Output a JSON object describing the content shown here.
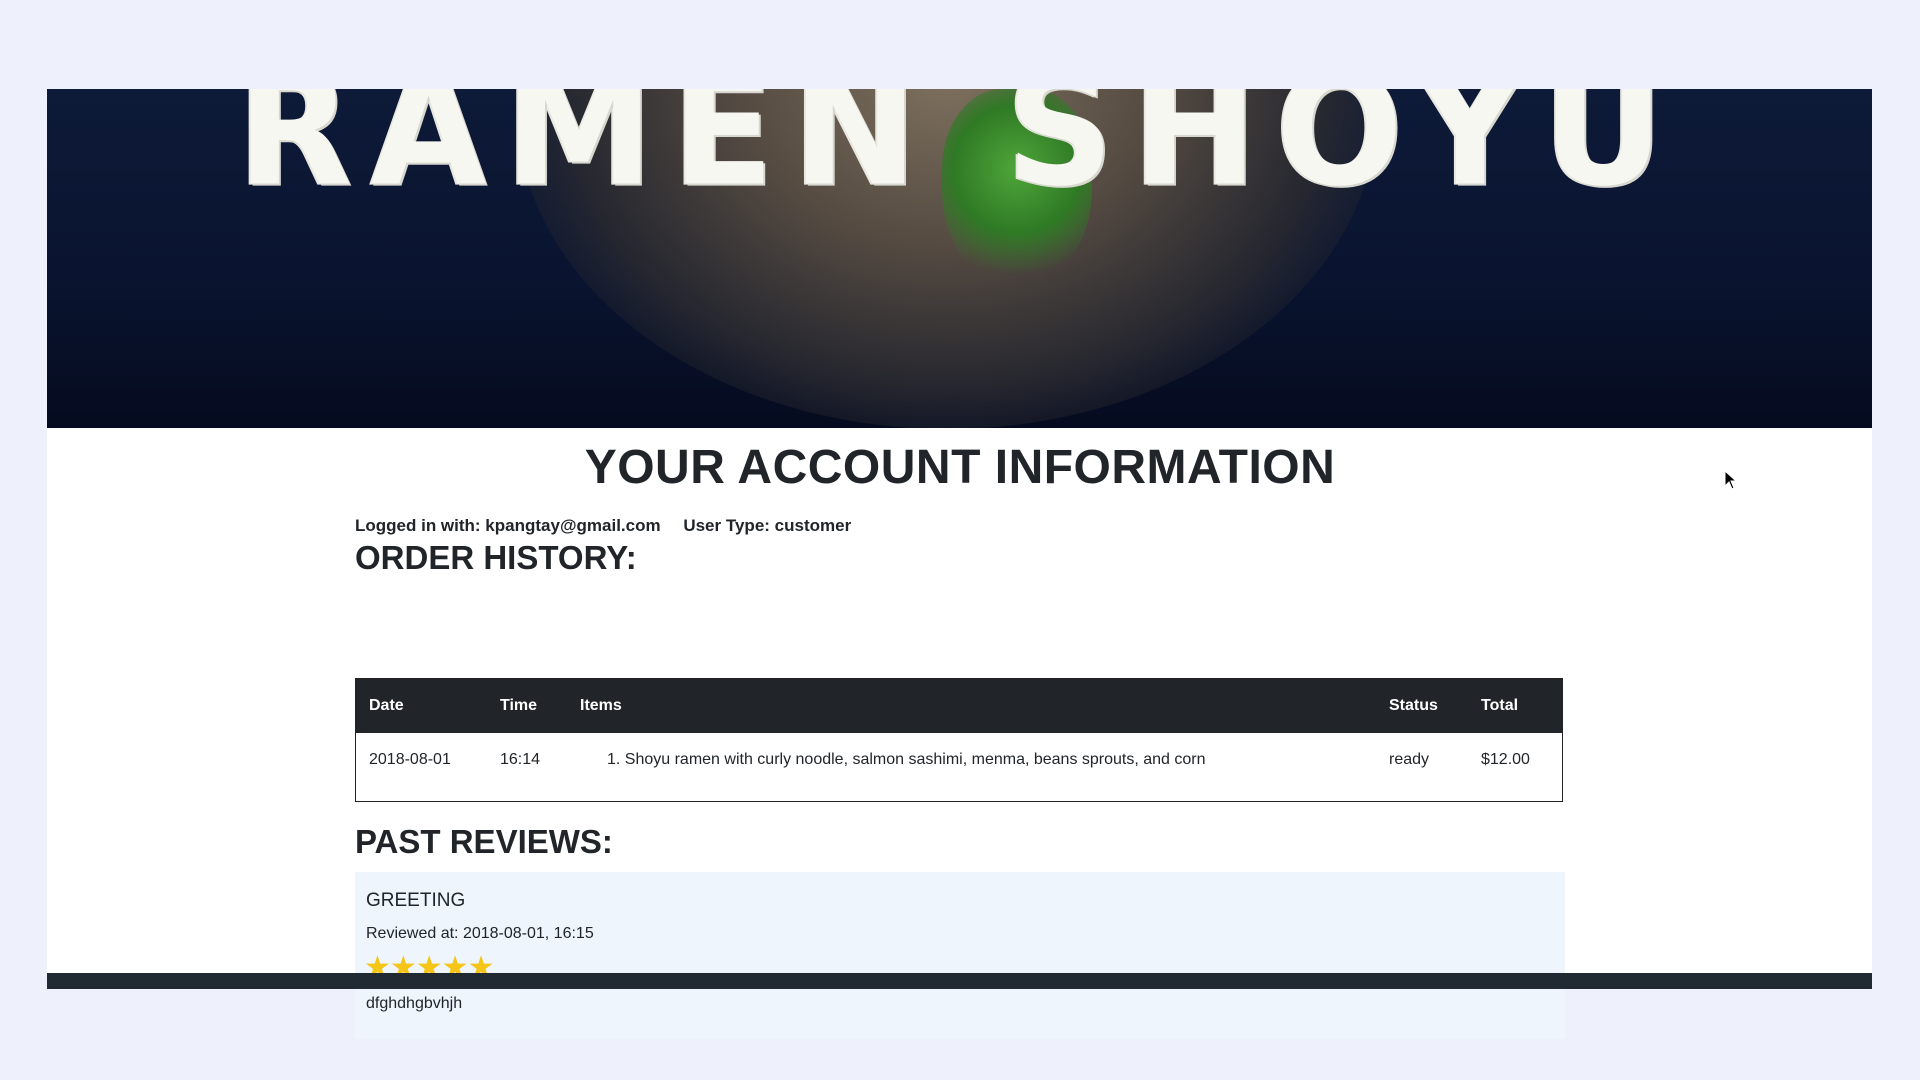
{
  "hero": {
    "brand": "RAMEN SHOYU"
  },
  "page": {
    "title": "YOUR ACCOUNT INFORMATION"
  },
  "account": {
    "logged_in": "Logged in with: kpangtay@gmail.com",
    "user_type": "User Type: customer"
  },
  "order_history": {
    "heading": "ORDER HISTORY:",
    "columns": [
      "Date",
      "Time",
      "Items",
      "Status",
      "Total"
    ],
    "rows": [
      {
        "date": "2018-08-01",
        "time": "16:14",
        "items": "1. Shoyu ramen with curly noodle, salmon sashimi, menma, beans sprouts, and corn",
        "status": "ready",
        "total": "$12.00"
      }
    ]
  },
  "reviews": {
    "heading": "PAST REVIEWS:",
    "items": [
      {
        "title": "GREETING",
        "reviewed_at": "Reviewed at: 2018-08-01, 16:15",
        "stars": "★★★★★",
        "rating": 5,
        "text": "dfghdhgbvhjh"
      }
    ]
  },
  "colors": {
    "page_bg": "#eef0fb",
    "header_dark": "#212529",
    "star": "#f5c518",
    "review_bg": "#eef5fd"
  }
}
